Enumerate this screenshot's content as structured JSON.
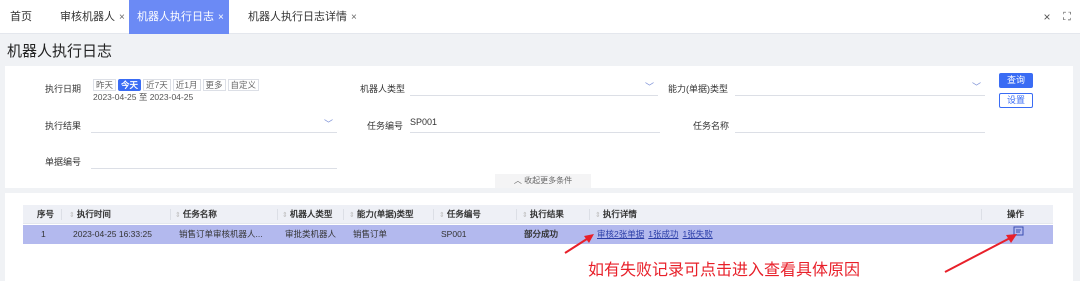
{
  "tabs": [
    {
      "label": "首页",
      "closable": false
    },
    {
      "label": "审核机器人",
      "closable": true
    },
    {
      "label": "机器人执行日志",
      "closable": true,
      "active": true
    },
    {
      "label": "机器人执行日志详情",
      "closable": true
    }
  ],
  "tab_close_glyph": "×",
  "tab_controls": {
    "close_all": "×",
    "fullscreen": "⛶"
  },
  "page_title": "机器人执行日志",
  "filters": {
    "exec_date_label": "执行日期",
    "date_chips": [
      "昨天",
      "今天",
      "近7天",
      "近1月",
      "更多",
      "自定义"
    ],
    "date_chip_selected": "今天",
    "date_range": "2023-04-25 至 2023-04-25",
    "robot_type_label": "机器人类型",
    "robot_type_value": "",
    "capability_type_label": "能力(单据)类型",
    "capability_type_value": "",
    "exec_result_label": "执行结果",
    "exec_result_value": "",
    "task_no_label": "任务编号",
    "task_no_value": "SP001",
    "task_name_label": "任务名称",
    "task_name_value": "",
    "doc_no_label": "单据编号",
    "doc_no_value": "",
    "collapse_label": "收起更多条件",
    "query_button": "查询",
    "settings_button": "设置"
  },
  "table": {
    "columns": [
      "序号",
      "执行时间",
      "任务名称",
      "机器人类型",
      "能力(单据)类型",
      "任务编号",
      "执行结果",
      "执行详情",
      "操作"
    ],
    "rows": [
      {
        "index": "1",
        "exec_time": "2023-04-25 16:33:25",
        "task_name": "销售订单审核机器人...",
        "robot_type": "审批类机器人",
        "capability_type": "销售订单",
        "task_no": "SP001",
        "result": "部分成功",
        "detail_links": [
          "审核2张单据",
          "1张成功",
          "1张失败"
        ],
        "action_icon": "view-log-icon"
      }
    ]
  },
  "annotation": {
    "text": "如有失败记录可点击进入查看具体原因",
    "color": "#e8202a"
  },
  "colors": {
    "accent": "#3a6cf4",
    "active_tab": "#6b8af5",
    "selected_row": "#b3b9ee"
  }
}
